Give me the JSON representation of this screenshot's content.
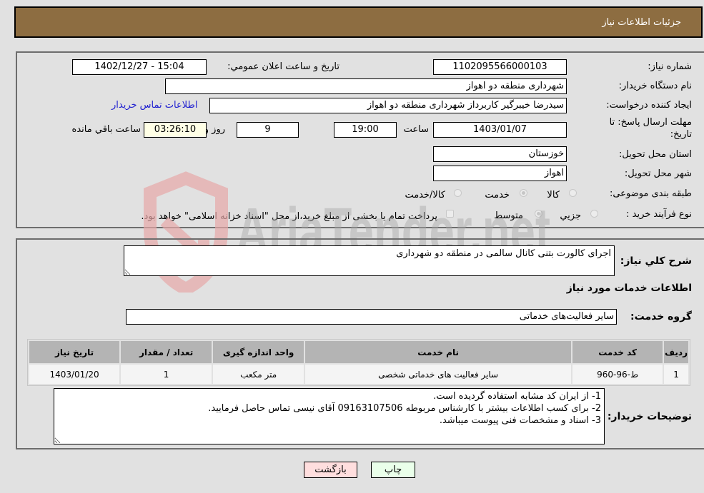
{
  "header": {
    "title": "جزئیات اطلاعات نیاز"
  },
  "fields": {
    "need_number_label": "شماره نیاز:",
    "need_number": "1102095566000103",
    "announce_label": "تاریخ و ساعت اعلان عمومي:",
    "announce_value": "1402/12/27 - 15:04",
    "buyer_org_label": "نام دستگاه خریدار:",
    "buyer_org": "شهرداری منطقه دو اهواز",
    "requester_label": "ایجاد کننده درخواست:",
    "requester": "سیدرضا خیبرگیر کاربرداز  شهرداری منطقه دو اهواز",
    "buyer_contact_link": "اطلاعات تماس خریدار",
    "deadline_label_line1": "مهلت ارسال پاسخ: تا",
    "deadline_label_line2": "تاریخ:",
    "deadline_date": "1403/01/07",
    "time_label": "ساعت",
    "deadline_time": "19:00",
    "days_value": "9",
    "days_label": "روز و",
    "remaining_time": "03:26:10",
    "remaining_label": "ساعت باقي مانده",
    "province_label": "استان محل تحویل:",
    "province": "خوزستان",
    "city_label": "شهر محل تحویل:",
    "city": "اهواز",
    "category_label": "طبقه بندی موضوعی:",
    "category_options": [
      "کالا",
      "خدمت",
      "کالا/خدمت"
    ],
    "category_selected": "خدمت",
    "process_label": "نوع فرآیند خرید :",
    "process_options": [
      "جزيي",
      "متوسط"
    ],
    "process_selected": "متوسط",
    "payment_note": "پرداخت تمام یا بخشی از مبلغ خرید،از محل \"اسناد خزانه اسلامی\" خواهد بود."
  },
  "details": {
    "summary_label": "شرح کلي نیاز:",
    "summary": "اجرای کالورت بتنی کانال سالمی در منطقه دو شهرداری",
    "services_heading": "اطلاعات خدمات مورد نیاز",
    "service_group_label": "گروه خدمت:",
    "service_group": "سایر فعالیت‌های خدماتی",
    "table": {
      "headers": [
        "ردیف",
        "کد خدمت",
        "نام خدمت",
        "واحد اندازه گیری",
        "تعداد / مقدار",
        "تاریخ نیاز"
      ],
      "rows": [
        [
          "1",
          "ط-96-960",
          "سایر فعالیت های خدماتی شخصی",
          "متر مکعب",
          "1",
          "1403/01/20"
        ]
      ]
    },
    "buyer_notes_label": "توضیحات خریدار:",
    "buyer_notes": "1- از ایران کد مشابه استفاده گردیده است.\n2- برای کسب اطلاعات بیشتر با کارشناس مربوطه 09163107506 آقای نیسی تماس حاصل فرمایید.\n3- اسناد و مشخصات فنی پیوست میباشد."
  },
  "buttons": {
    "print": "چاپ",
    "back": "بازگشت"
  },
  "watermark": {
    "text": "AriaTender.net"
  },
  "colors": {
    "header_bg": "#8d6d41",
    "page_bg": "#e1e1e1",
    "back_btn": "#ffdede",
    "print_btn": "#eaffea",
    "link": "#2020d0"
  }
}
